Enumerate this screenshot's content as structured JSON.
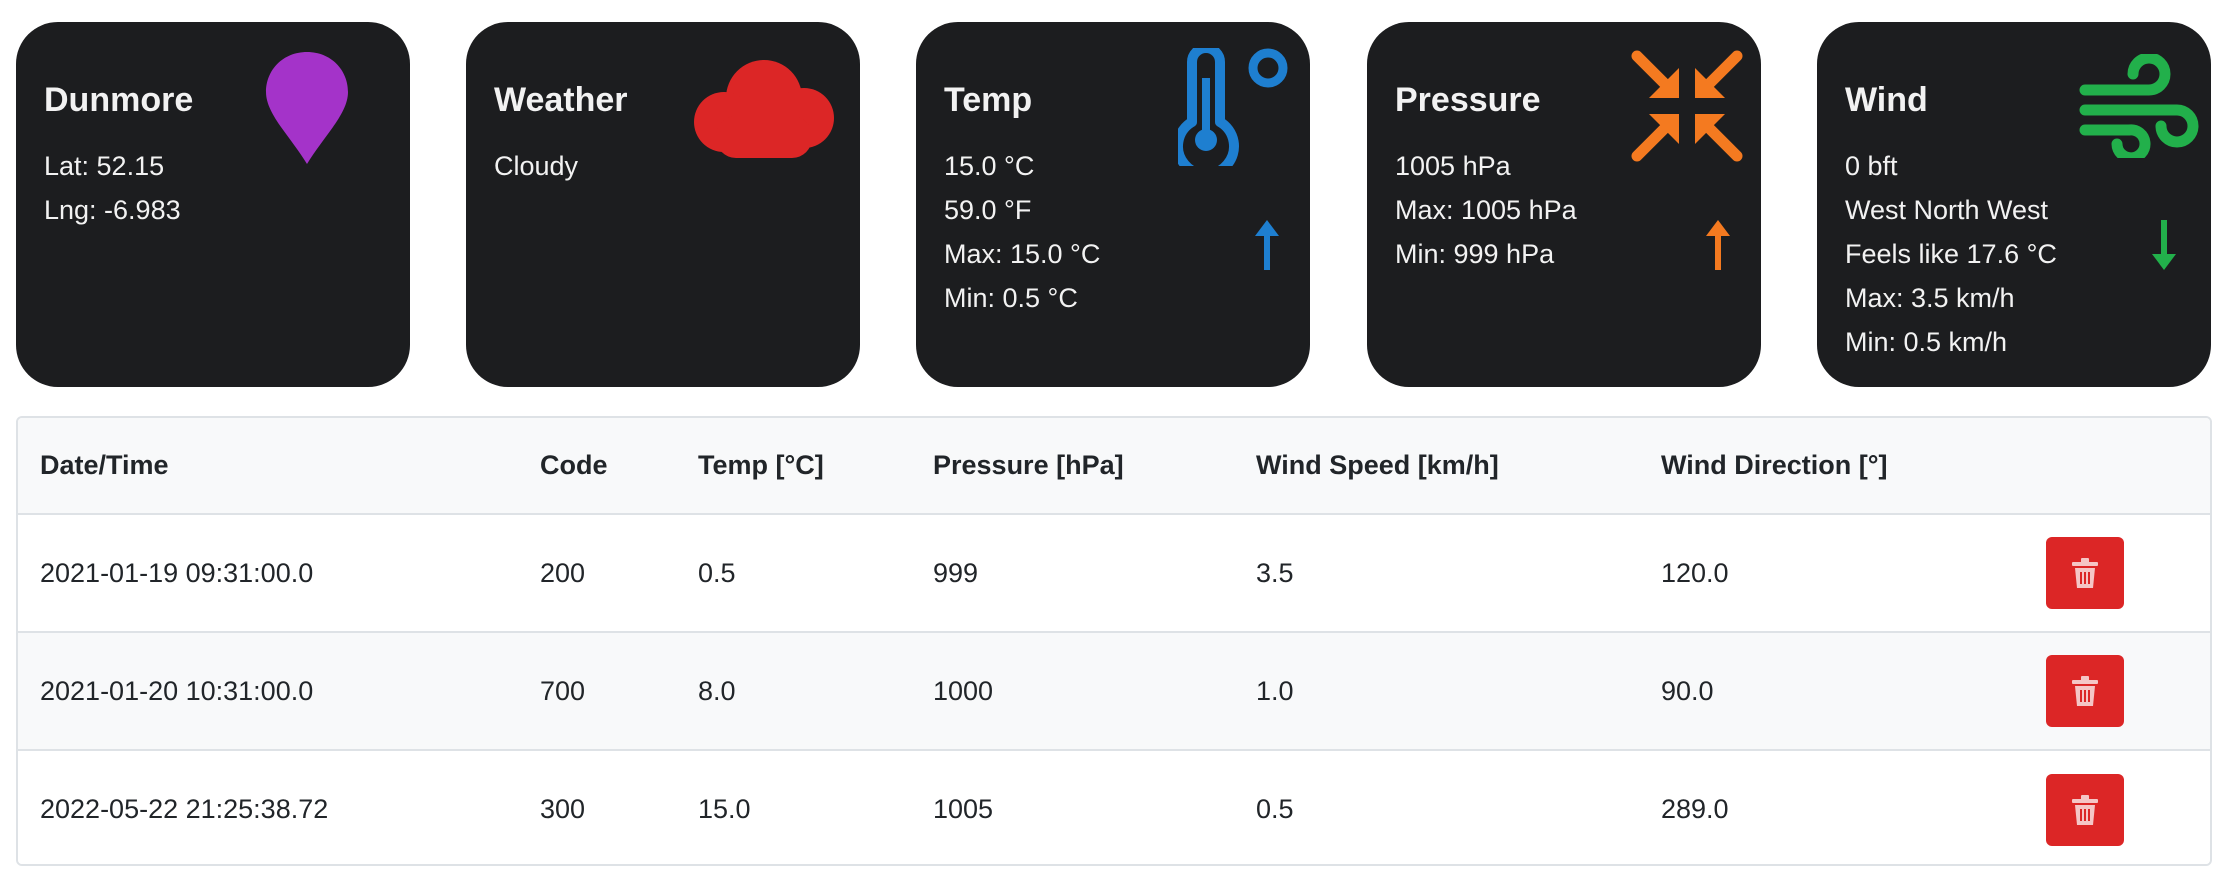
{
  "cards": [
    {
      "title": "Dunmore",
      "lines": [
        "Lat: 52.15",
        "Lng: -6.983"
      ],
      "icon": "map-pin-icon",
      "color": "#a433c9"
    },
    {
      "title": "Weather",
      "lines": [
        "Cloudy"
      ],
      "icon": "cloud-icon",
      "color": "#dc2626"
    },
    {
      "title": "Temp",
      "lines": [
        "15.0 °C",
        "59.0 °F",
        "Max: 15.0 °C",
        "Min: 0.5 °C"
      ],
      "icon": "thermometer-icon",
      "trend": "arrow-up-icon",
      "color": "#1e7fd0"
    },
    {
      "title": "Pressure",
      "lines": [
        "1005 hPa",
        "Max: 1005 hPa",
        "Min: 999 hPa"
      ],
      "icon": "compress-icon",
      "trend": "arrow-up-icon",
      "color": "#f47a20"
    },
    {
      "title": "Wind",
      "lines": [
        "0 bft",
        "West North West",
        "Feels like 17.6 °C",
        "Max: 3.5 km/h",
        "Min: 0.5 km/h"
      ],
      "icon": "wind-icon",
      "trend": "arrow-down-icon",
      "color": "#22b04b"
    }
  ],
  "table": {
    "headers": [
      "Date/Time",
      "Code",
      "Temp [°C]",
      "Pressure [hPa]",
      "Wind Speed [km/h]",
      "Wind Direction [°]",
      ""
    ],
    "rows": [
      [
        "2021-01-19 09:31:00.0",
        "200",
        "0.5",
        "999",
        "3.5",
        "120.0"
      ],
      [
        "2021-01-20 10:31:00.0",
        "700",
        "8.0",
        "1000",
        "1.0",
        "90.0"
      ],
      [
        "2022-05-22 21:25:38.72",
        "300",
        "15.0",
        "1005",
        "0.5",
        "289.0"
      ]
    ],
    "delete_icon": "trash-icon",
    "delete_color": "#dc2626"
  }
}
